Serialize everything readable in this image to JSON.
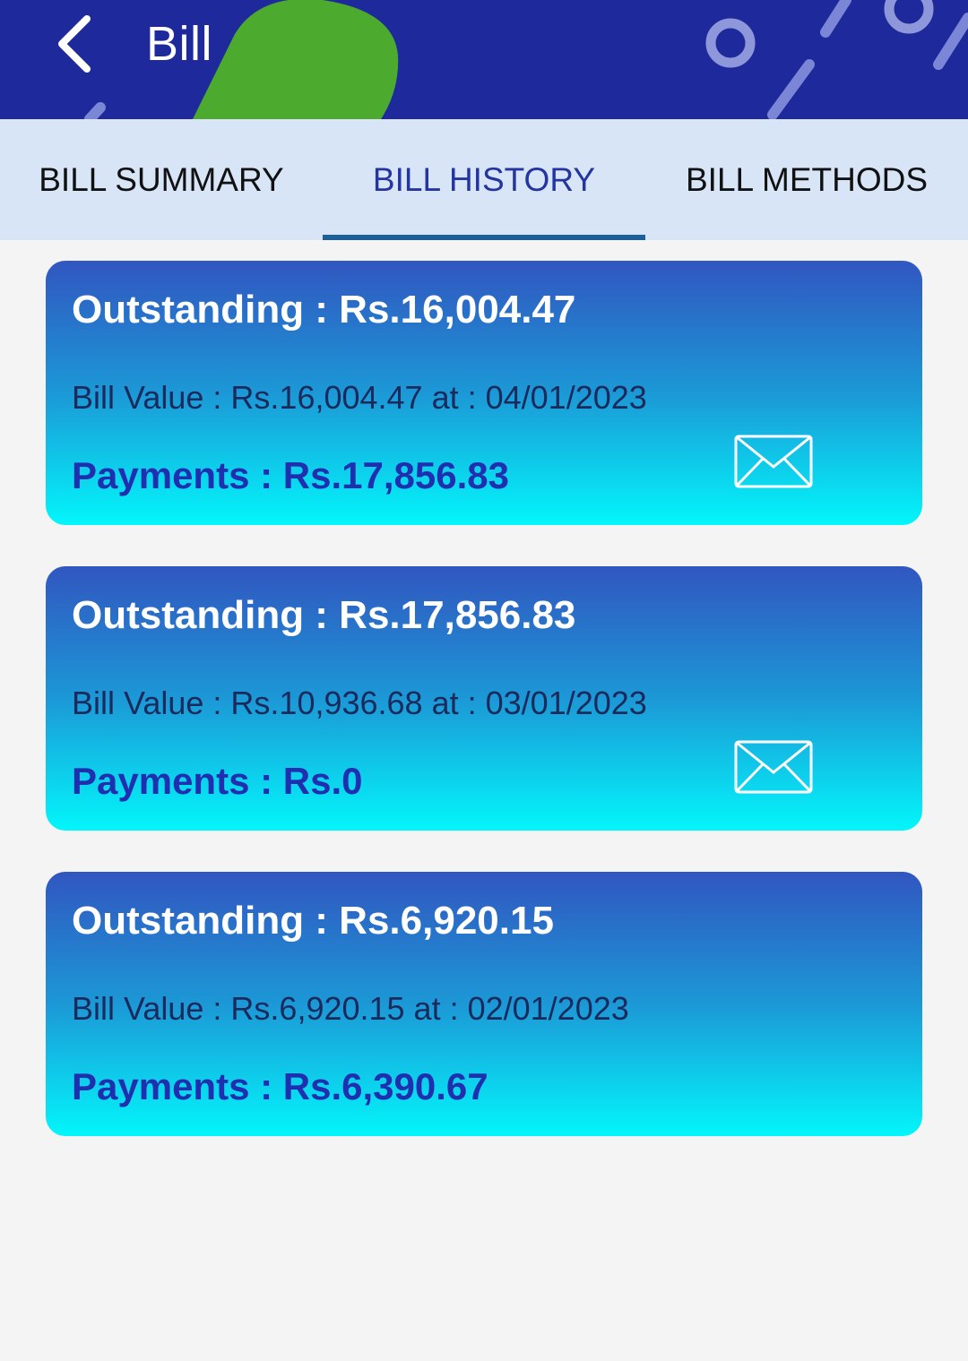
{
  "header": {
    "title": "Bill",
    "back_icon": "chevron-left-icon",
    "bg_color": "#1e2a9c"
  },
  "tabs": [
    {
      "label": "BILL SUMMARY",
      "active": false
    },
    {
      "label": "BILL HISTORY",
      "active": true
    },
    {
      "label": "BILL METHODS",
      "active": false
    }
  ],
  "bills": [
    {
      "outstanding": "Outstanding : Rs.16,004.47",
      "bill_value": "Bill Value : Rs.16,004.47 at : 04/01/2023",
      "payments": "Payments : Rs.17,856.83",
      "has_mail": true
    },
    {
      "outstanding": "Outstanding : Rs.17,856.83",
      "bill_value": "Bill Value : Rs.10,936.68 at : 03/01/2023",
      "payments": "Payments : Rs.0",
      "has_mail": true
    },
    {
      "outstanding": "Outstanding : Rs.6,920.15",
      "bill_value": "Bill Value : Rs.6,920.15 at : 02/01/2023",
      "payments": "Payments : Rs.6,390.67",
      "has_mail": false
    }
  ],
  "colors": {
    "accent": "#2434a0",
    "tab_bar": "#d7e5f6",
    "card_top": "#3156c0",
    "card_bottom": "#03f6fb"
  }
}
